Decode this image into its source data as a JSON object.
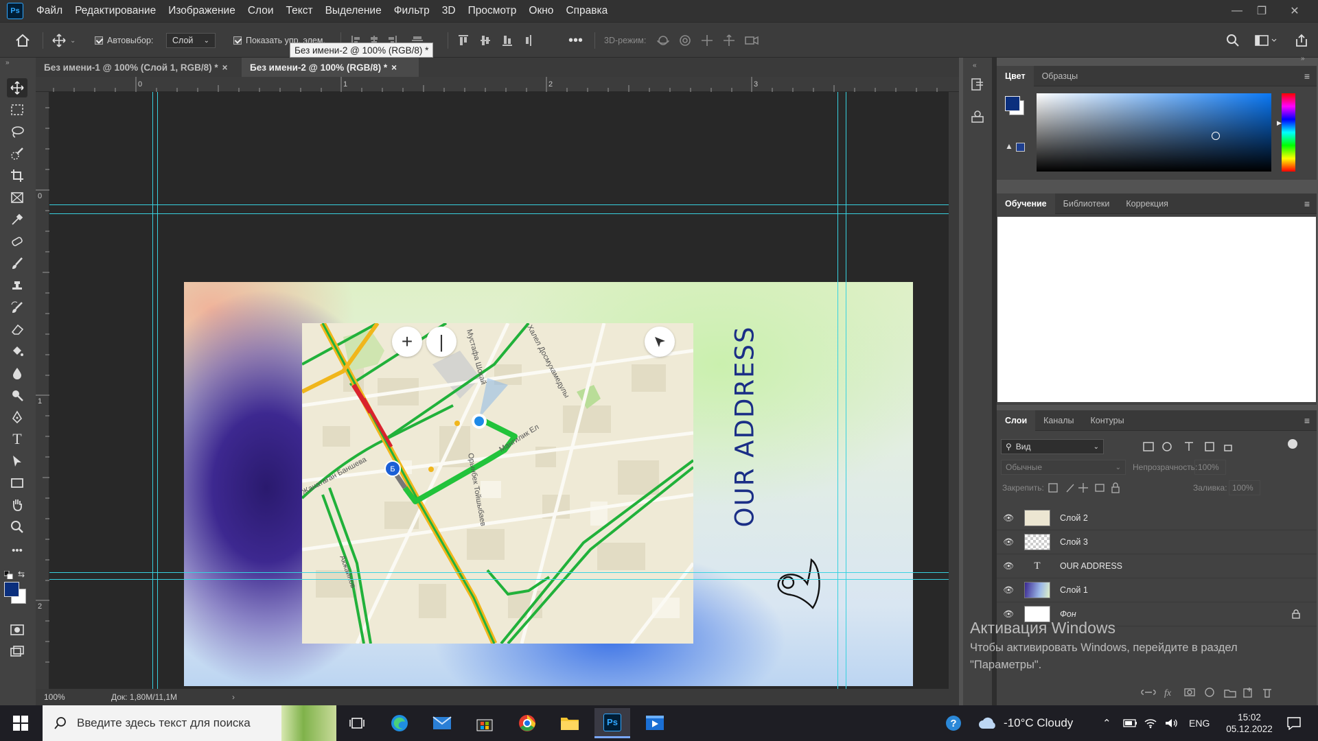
{
  "menu": {
    "logo": "Ps",
    "items": [
      "Файл",
      "Редактирование",
      "Изображение",
      "Слои",
      "Текст",
      "Выделение",
      "Фильтр",
      "3D",
      "Просмотр",
      "Окно",
      "Справка"
    ]
  },
  "options": {
    "autoselect_label": "Автовыбор:",
    "autoselect_value": "Слой",
    "show_controls_label": "Показать упр. элем.",
    "mode_3d_label": "3D-режим:"
  },
  "tooltip": "Без имени-2 @ 100% (RGB/8) *",
  "doc_tabs": [
    {
      "label": "Без имени-1 @ 100% (Слой 1, RGB/8) *",
      "active": false
    },
    {
      "label": "Без имени-2 @ 100% (RGB/8) *",
      "active": true
    }
  ],
  "rulers": {
    "h": [
      "0",
      "1",
      "2",
      "3"
    ],
    "v": [
      "0",
      "1",
      "2"
    ]
  },
  "canvas": {
    "address_text": "OUR ADDRESS"
  },
  "map": {
    "streets": [
      "Мустафа Шокай",
      "Халел Досмухамедулы",
      "Мангилик Ел",
      "Орынбек Тойшыбаев",
      "Жанатаған Баншева",
      "Акжайнов"
    ],
    "route_badge": "Б"
  },
  "status": {
    "zoom": "100%",
    "doc": "Док: 1,80M/11,1M"
  },
  "color_panel": {
    "tabs": [
      "Цвет",
      "Образцы"
    ],
    "fg": "#0b2f7d",
    "bg": "#ffffff"
  },
  "learn_panel": {
    "tabs": [
      "Обучение",
      "Библиотеки",
      "Коррекция"
    ]
  },
  "layers_panel": {
    "tabs": [
      "Слои",
      "Каналы",
      "Контуры"
    ],
    "filter_label": "Вид",
    "blend_mode": "Обычные",
    "opacity_label": "Непрозрачность:",
    "opacity_value": "100%",
    "lock_label": "Закрепить:",
    "fill_label": "Заливка:",
    "fill_value": "100%",
    "layers": [
      {
        "name": "Слой 2",
        "kind": "map"
      },
      {
        "name": "Слой 3",
        "kind": "checker"
      },
      {
        "name": "OUR ADDRESS",
        "kind": "text"
      },
      {
        "name": "Слой 1",
        "kind": "gradient"
      },
      {
        "name": "Фон",
        "kind": "white",
        "locked": true
      }
    ]
  },
  "watermark": {
    "title": "Активация Windows",
    "body": "Чтобы активировать Windows, перейдите в раздел \"Параметры\"."
  },
  "taskbar": {
    "search_placeholder": "Введите здесь текст для поиска",
    "weather": "-10°C  Cloudy",
    "lang": "ENG",
    "time": "15:02",
    "date": "05.12.2022"
  }
}
